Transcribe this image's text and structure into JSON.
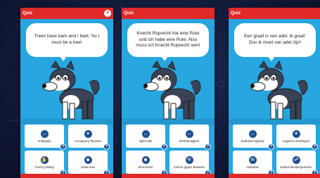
{
  "screens": [
    {
      "title": "Quiz",
      "close_icon": "close-icon",
      "speech": "Trees have bark and I bark. So I must be a tree!",
      "answers": [
        {
          "label": "Ambiguity",
          "icon": "arrows-icon"
        },
        {
          "label": "Conspiracy theories",
          "icon": "lightbulb-icon"
        },
        {
          "label": "Cherry picking",
          "icon": "hand-icon"
        },
        {
          "label": "Straw man",
          "icon": "person-icon"
        }
      ]
    },
    {
      "title": "Quiz",
      "close_icon": "close-icon",
      "speech": "Knecht Ruprecht hat eine Rute und ich habe eine Rute. Also muss ich Knecht Ruprecht sein!",
      "answers": [
        {
          "label": "Opferrolle",
          "icon": "arrows-icon"
        },
        {
          "label": "Mehrdeutigkeit",
          "icon": "arrows-icon"
        },
        {
          "label": "Strohmann",
          "icon": "person-icon"
        },
        {
          "label": "Immun gegen Beweise",
          "icon": "shield-icon"
        }
      ]
    },
    {
      "title": "Quiz",
      "close_icon": "close-icon",
      "speech": "Een graaf is van adel, ik graaf. Dus ik moet van adel zijn!",
      "answers": [
        {
          "label": "Dubbelzinnigheid",
          "icon": "arrows-icon"
        },
        {
          "label": "Logische denkfegen",
          "icon": "lightbulb-icon"
        },
        {
          "label": "Anekdote",
          "icon": "speech-icon"
        },
        {
          "label": "Dakvol beeldergestoren",
          "icon": "people-icon"
        }
      ]
    }
  ],
  "colors": {
    "accent_red": "#e02a2a",
    "screen_blue": "#27a6e0",
    "icon_navy": "#1d4f93",
    "background": "#131b3b"
  }
}
